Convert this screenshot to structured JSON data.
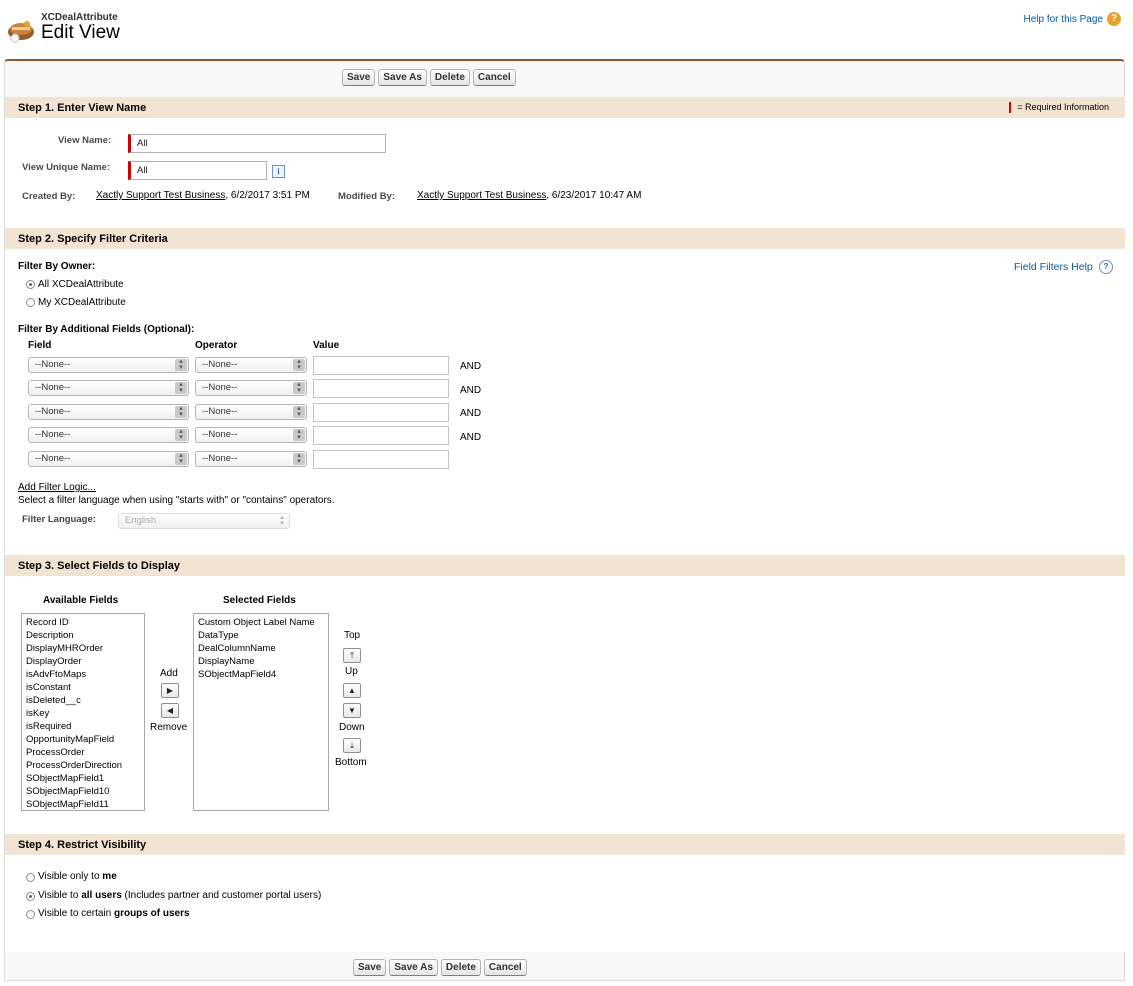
{
  "header": {
    "object_name": "XCDealAttribute",
    "title": "Edit View",
    "help_link": "Help for this Page",
    "help_icon": "?"
  },
  "buttons": {
    "save": "Save",
    "save_as": "Save As",
    "delete": "Delete",
    "cancel": "Cancel"
  },
  "step1": {
    "title": "Step 1. Enter View Name",
    "required_info": "= Required Information",
    "view_name_label": "View Name:",
    "view_name_value": "All",
    "unique_name_label": "View Unique Name:",
    "unique_name_value": "All",
    "info_icon": "i",
    "created_by_label": "Created By:",
    "created_by_user": "Xactly Support Test Business",
    "created_by_date": ", 6/2/2017 3:51 PM",
    "modified_by_label": "Modified By:",
    "modified_by_user": "Xactly Support Test Business",
    "modified_by_date": ", 6/23/2017 10:47 AM"
  },
  "step2": {
    "title": "Step 2. Specify Filter Criteria",
    "filter_by_owner": "Filter By Owner:",
    "field_filters_help": "Field Filters Help",
    "owner_options": [
      "All XCDealAttribute",
      "My XCDealAttribute"
    ],
    "owner_selected": 0,
    "filter_additional": "Filter By Additional Fields (Optional):",
    "col_field": "Field",
    "col_operator": "Operator",
    "col_value": "Value",
    "rows": [
      {
        "field": "--None--",
        "operator": "--None--",
        "value": "",
        "conj": "AND"
      },
      {
        "field": "--None--",
        "operator": "--None--",
        "value": "",
        "conj": "AND"
      },
      {
        "field": "--None--",
        "operator": "--None--",
        "value": "",
        "conj": "AND"
      },
      {
        "field": "--None--",
        "operator": "--None--",
        "value": "",
        "conj": "AND"
      },
      {
        "field": "--None--",
        "operator": "--None--",
        "value": "",
        "conj": ""
      }
    ],
    "add_filter_logic": "Add Filter Logic...",
    "filter_language_note": "Select a filter language when using \"starts with\" or \"contains\" operators.",
    "filter_language_label": "Filter Language:",
    "filter_language_value": "English"
  },
  "step3": {
    "title": "Step 3. Select Fields to Display",
    "available_label": "Available Fields",
    "selected_label": "Selected Fields",
    "available": [
      "Record ID",
      "Description",
      "DisplayMHROrder",
      "DisplayOrder",
      "isAdvFtoMaps",
      "isConstant",
      "isDeleted__c",
      "isKey",
      "isRequired",
      "OpportunityMapField",
      "ProcessOrder",
      "ProcessOrderDirection",
      "SObjectMapField1",
      "SObjectMapField10",
      "SObjectMapField11"
    ],
    "selected": [
      "Custom Object Label Name",
      "DataType",
      "DealColumnName",
      "DisplayName",
      "SObjectMapField4"
    ],
    "add": "Add",
    "remove": "Remove",
    "top": "Top",
    "up": "Up",
    "down": "Down",
    "bottom": "Bottom"
  },
  "step4": {
    "title": "Step 4. Restrict Visibility",
    "options": [
      {
        "pre": "Visible only to ",
        "bold": "me",
        "post": ""
      },
      {
        "pre": "Visible to ",
        "bold": "all users",
        "post": " (Includes partner and customer portal users)"
      },
      {
        "pre": "Visible to certain ",
        "bold": "groups of users",
        "post": ""
      }
    ],
    "selected": 1
  }
}
